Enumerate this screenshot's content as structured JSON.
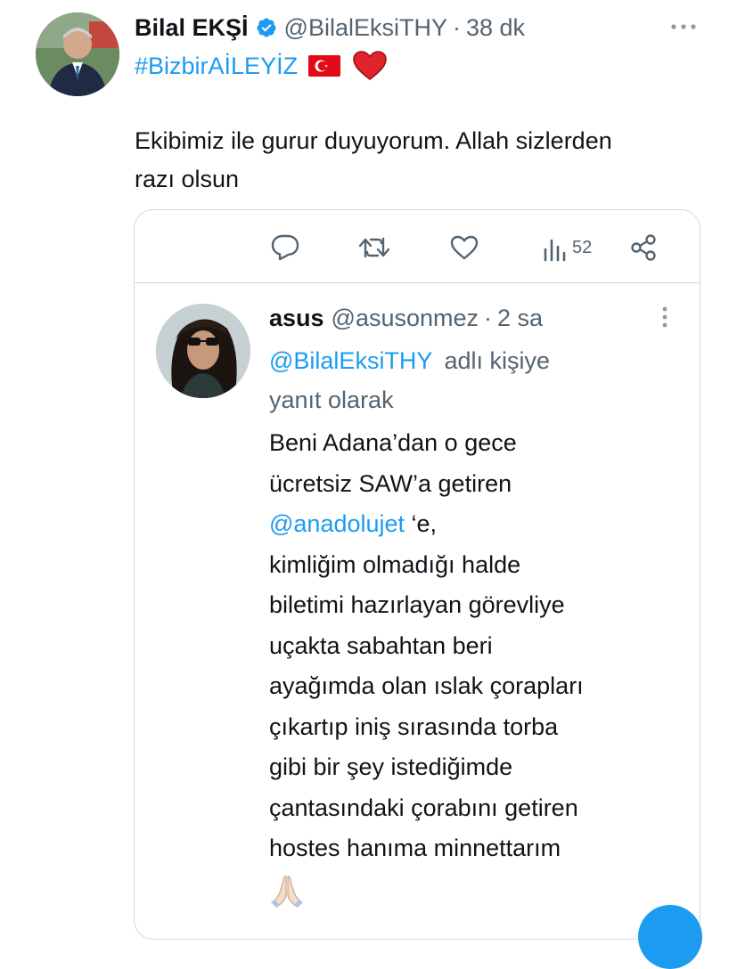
{
  "tweet": {
    "author_name": "Bilal EKŞİ",
    "author_handle": "@BilalEksiTHY",
    "separator": "·",
    "time": "38 dk",
    "bio_hashtag": "#BizbirAİLEYİZ",
    "flag_emoji": "🇹🇷",
    "heart_emoji": "❤️",
    "text_line1": "Ekibimiz ile gurur duyuyorum. Allah sizlerden",
    "text_line2": "razı olsun",
    "more_icon": "more-horizontal-icon"
  },
  "actions": {
    "views_count": "52",
    "icons": [
      "reply-icon",
      "retweet-icon",
      "like-icon",
      "views-icon",
      "share-icon"
    ]
  },
  "quoted": {
    "author_name": "asus",
    "author_handle": "@asusonmez",
    "separator": "·",
    "time": "2 sa",
    "reply_to_handle": "@BilalEksiTHY",
    "reply_to_suffix": "adlı kişiye",
    "reply_to_line2": "yanıt olarak",
    "lines": [
      "Beni Adana’dan o gece",
      "ücretsiz SAW’a getiren",
      "",
      "kimliğim olmadığı halde",
      "biletimi hazırlayan görevliye",
      "uçakta sabahtan beri",
      "ayağımda olan ıslak çorapları",
      "çıkartıp iniş sırasında torba",
      "gibi bir şey istediğimde",
      "çantasındaki çorabını getiren",
      "hostes hanıma minnettarım"
    ],
    "mention": "@anadolujet",
    "mention_suffix": " ‘e,",
    "emoji": "🙏🏻",
    "more_icon": "more-vertical-icon"
  },
  "colors": {
    "link": "#1d9bf0",
    "muted": "#536471",
    "border": "#cfd9de"
  }
}
